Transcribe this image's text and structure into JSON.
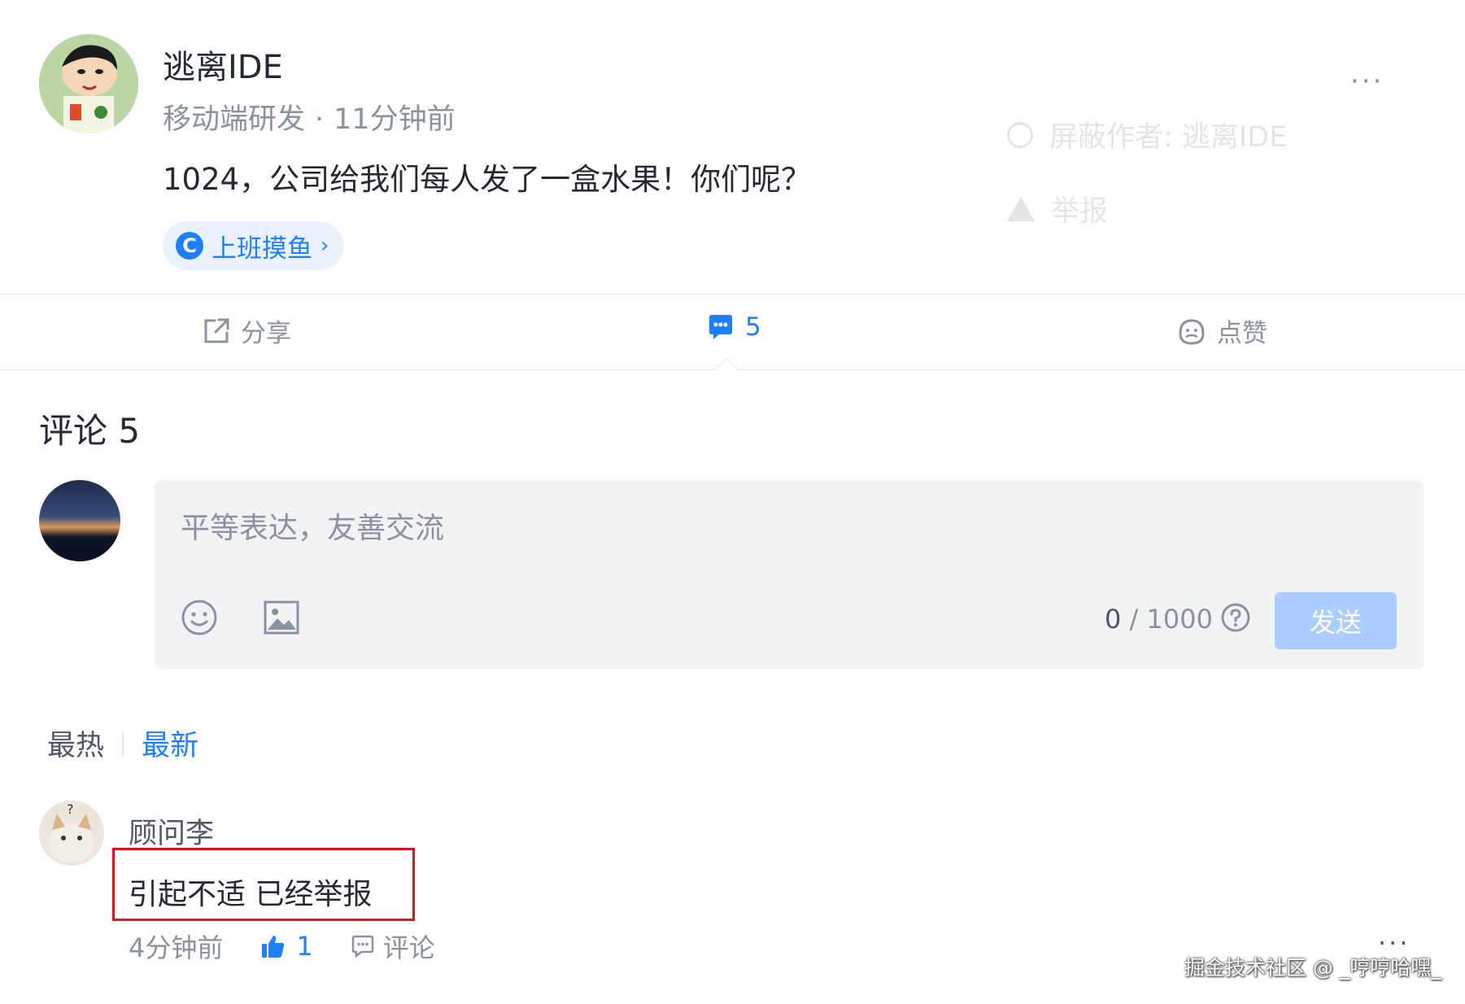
{
  "post": {
    "author_name": "逃离IDE",
    "author_title": "移动端研发",
    "meta_dot": "·",
    "time": "11分钟前",
    "content": "1024，公司给我们每人发了一盒水果！你们呢？",
    "topic": "上班摸鱼",
    "more": "···"
  },
  "popup_menu": {
    "block_author": "屏蔽作者: 逃离IDE",
    "report": "举报"
  },
  "actions": {
    "share": "分享",
    "comment_count": "5",
    "like": "点赞"
  },
  "comments": {
    "title": "评论 5",
    "input_placeholder": "平等表达，友善交流",
    "char_current": "0",
    "char_max": "/ 1000",
    "send": "发送",
    "sort_hot": "最热",
    "sort_new": "最新",
    "items": [
      {
        "user": "顾问李",
        "text": "引起不适 已经举报",
        "time": "4分钟前",
        "likes": "1",
        "reply": "评论",
        "more": "···"
      }
    ]
  },
  "watermark": "掘金技术社区 @ _哼哼哈嘿_",
  "colors": {
    "accent": "#1e80ff",
    "send_disabled": "#abcdff",
    "highlight": "#d9161e"
  }
}
